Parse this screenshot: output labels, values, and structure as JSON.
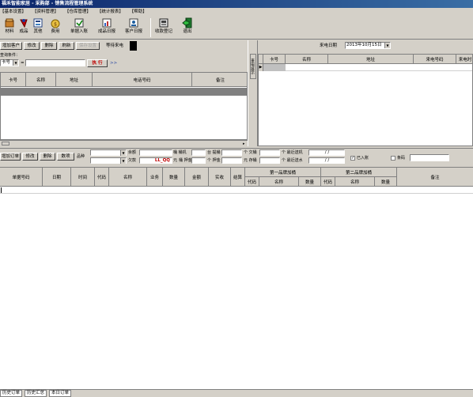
{
  "window": {
    "title": "福禾智能家居 - 采购部 - 销售流程管理系统"
  },
  "menu": [
    "【基本设置】",
    "【资料管理】",
    "【仓库管理】",
    "【统计报表】",
    "【帮助】"
  ],
  "toolbar": [
    {
      "label": "材料",
      "icon": "materials-icon"
    },
    {
      "label": "成品",
      "icon": "products-icon"
    },
    {
      "label": "其他",
      "icon": "other-icon"
    },
    {
      "label": "费用",
      "icon": "expense-icon"
    },
    {
      "label": "单据入账",
      "icon": "posting-icon"
    },
    {
      "label": "成品日报",
      "icon": "daily-report-icon"
    },
    {
      "label": "客户日报",
      "icon": "customer-report-icon"
    },
    {
      "label": "收款登记",
      "icon": "payment-icon"
    },
    {
      "label": "退出",
      "icon": "exit-icon"
    }
  ],
  "customer": {
    "buttons": [
      "增加客户",
      "修改",
      "删除",
      "刷新",
      "保存设置"
    ],
    "waiting_label": "等待来电",
    "query_label": "查询条件：",
    "field_select": "卡号",
    "operator": "=",
    "execute_label": "执 行",
    "more_label": ">>",
    "columns": [
      "卡号",
      "名称",
      "地址",
      "电话号码",
      "备注"
    ]
  },
  "side_tab": "来电显示",
  "call": {
    "date_label": "来电日期",
    "date_value": "2013年10月15日",
    "columns": [
      "卡号",
      "名称",
      "地址",
      "来电号码",
      "来电时"
    ]
  },
  "order": {
    "buttons": [
      "增加订单",
      "修改",
      "删除",
      "数项"
    ],
    "product_label": "品种",
    "fields": {
      "balance_label": "余额",
      "arrears_label": "欠款",
      "arrears_value": "LL_QQ",
      "unit_yuan": "元",
      "pieces1_label": "桶 桶机",
      "pieces2_label": "桶 押金",
      "pieces3_label": "台 提桶",
      "pieces4_label": "个 押金",
      "fill1_label": "个 欠桶",
      "fill2_label": "元 存桶",
      "recent_deliver_label": "个 最近送机",
      "recent_send_label": "个 最近送水",
      "date1": "/  /",
      "date2": "/  /",
      "stored_label": "已入账",
      "barcode_label": "条码"
    },
    "columns_top": [
      "单据号码",
      "日期",
      "时间",
      "代码",
      "名称",
      "业务",
      "数量",
      "金额",
      "实收",
      "结算",
      "第一品牌加桶",
      "第二品牌加桶",
      "备注"
    ],
    "columns_sub": [
      "代码",
      "名称",
      "数量",
      "代码",
      "名称",
      "数量"
    ]
  },
  "status_tabs": [
    "历史订单",
    "历史汇总",
    "本日订单"
  ]
}
